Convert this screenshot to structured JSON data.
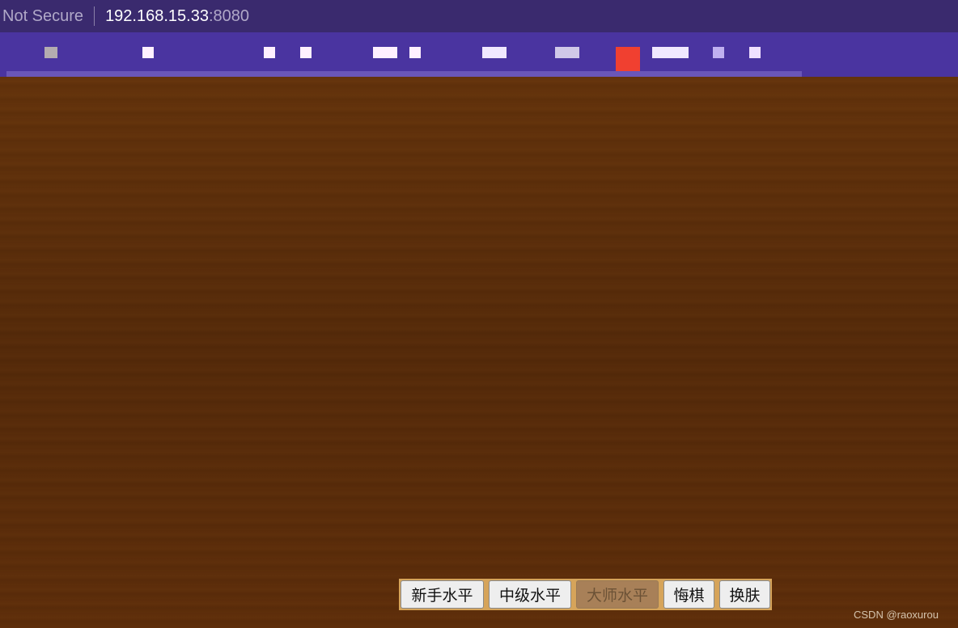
{
  "address_bar": {
    "security": "Not Secure",
    "host": "192.168.15.33",
    "port": ":8080"
  },
  "buttons": [
    {
      "label": "新手水平",
      "disabled": false
    },
    {
      "label": "中级水平",
      "disabled": false
    },
    {
      "label": "大师水平",
      "disabled": true
    },
    {
      "label": "悔棋",
      "disabled": false
    },
    {
      "label": "换肤",
      "disabled": false
    }
  ],
  "watermark": "CSDN @raoxurou"
}
